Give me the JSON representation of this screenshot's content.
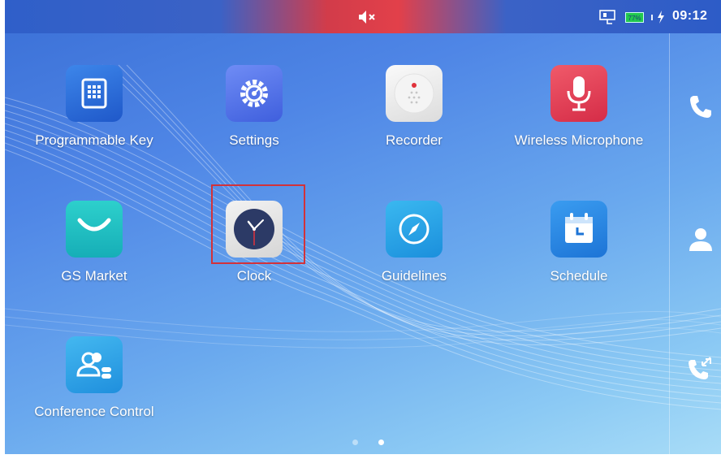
{
  "status_bar": {
    "mute_icon": "volume-mute-icon",
    "network_icon": "ethernet-icon",
    "battery_percent": 77,
    "battery_label": "77%",
    "charge_icon": "charging-bolt-icon",
    "time": "09:12",
    "mute_color": "#e2404a"
  },
  "apps": [
    {
      "label": "Programmable Key",
      "icon": "keypad-icon",
      "color": "#2f6fd8"
    },
    {
      "label": "Settings",
      "icon": "gear-icon",
      "color": "#4a6fe6"
    },
    {
      "label": "Recorder",
      "icon": "recorder-icon",
      "color": "#eeeeee"
    },
    {
      "label": "Wireless Microphone",
      "icon": "microphone-icon",
      "color": "#e23d57"
    },
    {
      "label": "GS Market",
      "icon": "shopping-bag-icon",
      "color": "#1fc1c7"
    },
    {
      "label": "Clock",
      "icon": "clock-icon",
      "color": "#e4e4e4"
    },
    {
      "label": "Guidelines",
      "icon": "compass-icon",
      "color": "#28a4e6"
    },
    {
      "label": "Schedule",
      "icon": "calendar-icon",
      "color": "#2b8ce6"
    },
    {
      "label": "Conference Control",
      "icon": "conference-users-icon",
      "color": "#2fa6e6"
    }
  ],
  "right_rail": [
    {
      "icon": "phone-icon"
    },
    {
      "icon": "contact-icon"
    },
    {
      "icon": "call-transfer-icon"
    }
  ],
  "page_indicator": {
    "total": 2,
    "current": 2
  }
}
